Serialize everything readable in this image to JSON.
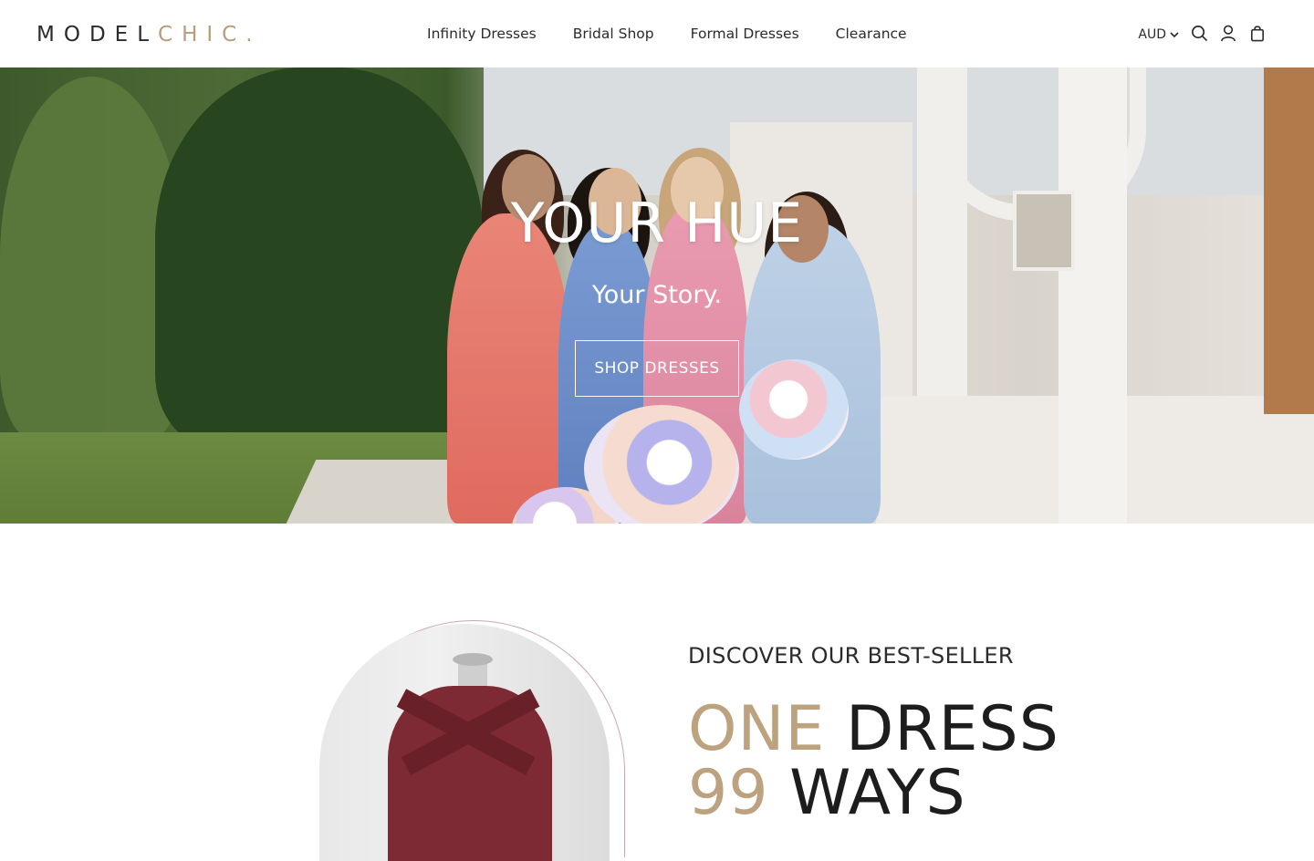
{
  "brand": {
    "logo_part1": "MODEL",
    "logo_part2": "CHIC.",
    "accent_color": "#b89c7c"
  },
  "nav": {
    "items": [
      {
        "label": "Infinity Dresses"
      },
      {
        "label": "Bridal Shop"
      },
      {
        "label": "Formal Dresses"
      },
      {
        "label": "Clearance"
      }
    ]
  },
  "tools": {
    "currency": "AUD",
    "icons": [
      "search-icon",
      "account-icon",
      "cart-icon"
    ]
  },
  "hero": {
    "title": "YOUR HUE",
    "subtitle": "Your Story.",
    "cta": "SHOP DRESSES"
  },
  "feature": {
    "eyebrow": "DISCOVER OUR BEST-SELLER",
    "line1_accent": "ONE",
    "line1_rest": "DRESS",
    "line2_accent": "99",
    "line2_rest": "WAYS"
  }
}
